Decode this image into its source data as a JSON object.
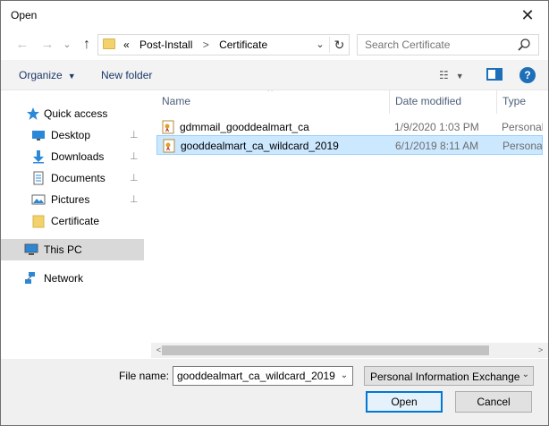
{
  "window": {
    "title": "Open",
    "close_glyph": "✕"
  },
  "nav": {
    "back_glyph": "←",
    "forward_glyph": "→",
    "history_glyph": "⌄",
    "up_glyph": "↑",
    "breadcrumb": {
      "overflow": "«",
      "items": [
        "Post-Install",
        "Certificate"
      ],
      "separator": ">"
    },
    "dropdown_glyph": "⌄",
    "refresh_glyph": "↻",
    "search_placeholder": "Search Certificate"
  },
  "toolbar": {
    "organize": "Organize",
    "organize_caret": "▼",
    "new_folder": "New folder",
    "view_glyph": "☷",
    "view_caret": "▼",
    "help_glyph": "?"
  },
  "sidebar": {
    "items": [
      {
        "label": "Quick access",
        "icon": "star-icon",
        "pinned": false
      },
      {
        "label": "Desktop",
        "icon": "desktop-icon",
        "pinned": true
      },
      {
        "label": "Downloads",
        "icon": "download-arrow-icon",
        "pinned": true
      },
      {
        "label": "Documents",
        "icon": "document-icon",
        "pinned": true
      },
      {
        "label": "Pictures",
        "icon": "pictures-icon",
        "pinned": true
      },
      {
        "label": "Certificate",
        "icon": "folder-icon",
        "pinned": false
      },
      {
        "label": "This PC",
        "icon": "computer-icon",
        "pinned": false
      },
      {
        "label": "Network",
        "icon": "network-icon",
        "pinned": false
      }
    ],
    "pin_glyph": "📌"
  },
  "columns": {
    "name": "Name",
    "date": "Date modified",
    "type": "Type",
    "sort_glyph": "^"
  },
  "files": [
    {
      "name": "gdmmail_gooddealmart_ca",
      "date": "1/9/2020 1:03 PM",
      "type": "Personal Information Exchange"
    },
    {
      "name": "gooddealmart_ca_wildcard_2019",
      "date": "6/1/2019 8:11 AM",
      "type": "Personal Information Exchange"
    }
  ],
  "scrollbar": {
    "left_glyph": "<",
    "right_glyph": ">"
  },
  "footer": {
    "file_name_label": "File name:",
    "file_name_value": "gooddealmart_ca_wildcard_2019",
    "dropdown_glyph": "⌄",
    "file_type": "Personal Information Exchange",
    "open": "Open",
    "cancel": "Cancel"
  },
  "colors": {
    "accent": "#0078d7",
    "selection": "#cce8ff",
    "folder": "#f3d16c"
  }
}
